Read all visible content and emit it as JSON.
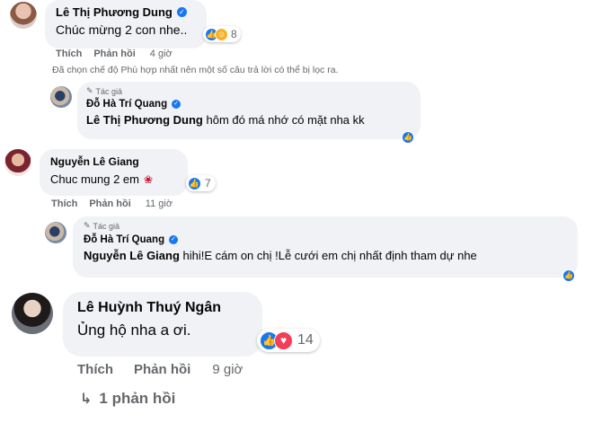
{
  "comments": [
    {
      "name": "Lê Thị Phương Dung",
      "text": "Chúc mừng 2 con nhe..",
      "reaction_count": "8",
      "actions": {
        "like": "Thích",
        "reply": "Phản hồi",
        "time": "4 giờ"
      }
    },
    {
      "name": "Nguyễn Lê Giang",
      "text": "Chuc mung 2 em",
      "reaction_count": "7",
      "actions": {
        "like": "Thích",
        "reply": "Phản hồi",
        "time": "11 giờ"
      }
    },
    {
      "name": "Lê Huỳnh Thuý Ngân",
      "text": "Ủng hộ nha a ơi.",
      "reaction_count": "14",
      "actions": {
        "like": "Thích",
        "reply": "Phản hồi",
        "time": "9 giờ"
      },
      "replies_link": "1 phản hồi"
    }
  ],
  "filter_notice": "Đã chọn chế độ Phù hợp nhất nên một số câu trả lời có thể bị lọc ra.",
  "replies": [
    {
      "author_badge": "Tác giả",
      "name": "Đỗ Hà Trí Quang",
      "mention": "Lê Thị Phương Dung",
      "text": " hôm đó má nhớ có mặt nha kk"
    },
    {
      "author_badge": "Tác giả",
      "name": "Đỗ Hà Trí Quang",
      "mention": "Nguyễn Lê Giang",
      "text": " hihi!E cám on chị !Lễ cưới em chị nhất định tham dự nhe"
    }
  ],
  "icons": {
    "verified": "verified-check-icon",
    "author": "pencil-icon",
    "like": "like-icon",
    "love": "love-icon",
    "care": "care-icon",
    "rose": "rose-emoji-icon",
    "reply_arrow": "reply-arrow-icon"
  },
  "colors": {
    "bubble": "#f0f2f5",
    "meta_text": "#65676b",
    "like_blue": "#1877f2",
    "love_red": "#f33e58"
  }
}
